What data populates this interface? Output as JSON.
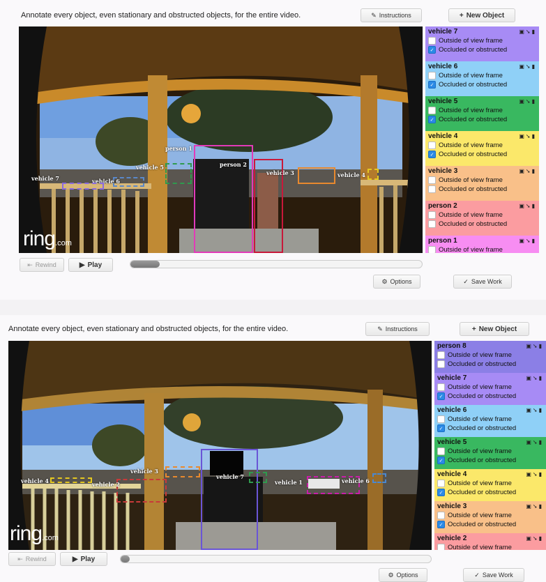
{
  "top": {
    "instruction": "Annotate every object, even stationary and obstructed objects, for the entire video.",
    "instructions_button": "Instructions",
    "new_object_button": "New Object",
    "rewind_button": "Rewind",
    "play_button": "Play",
    "options_button": "Options",
    "save_button": "Save Work",
    "progress": 0.1,
    "watermark": "ring",
    "watermark_suffix": ".com",
    "box_labels": {
      "person2": "person 2",
      "vehicle3": "vehicle 3",
      "vehicle4": "vehicle 4",
      "vehicle5": "vehicle 5",
      "vehicle6": "vehicle 6",
      "vehicle7": "vehicle 7",
      "person1": "person 1"
    },
    "objects": [
      {
        "name": "vehicle 7",
        "color": "#a78bf5",
        "outside": false,
        "occluded": true
      },
      {
        "name": "vehicle 6",
        "color": "#8fd0f7",
        "outside": false,
        "occluded": true
      },
      {
        "name": "vehicle 5",
        "color": "#39b860",
        "outside": false,
        "occluded": true
      },
      {
        "name": "vehicle 4",
        "color": "#fbe86a",
        "outside": false,
        "occluded": true
      },
      {
        "name": "vehicle 3",
        "color": "#f9c089",
        "outside": false,
        "occluded": false
      },
      {
        "name": "person 2",
        "color": "#fb9ca0",
        "outside": false,
        "occluded": false
      },
      {
        "name": "person 1",
        "color": "#f78df2",
        "outside": false,
        "occluded": false
      }
    ],
    "labels": {
      "outside": "Outside of view frame",
      "occluded": "Occluded or obstructed"
    }
  },
  "bottom": {
    "instruction": "Annotate every object, even stationary and obstructed objects, for the entire video.",
    "instructions_button": "Instructions",
    "new_object_button": "New Object",
    "rewind_button": "Rewind",
    "play_button": "Play",
    "options_button": "Options",
    "save_button": "Save Work",
    "progress": 0.03,
    "watermark": "ring",
    "watermark_suffix": ".com",
    "box_labels": {
      "vehicle7": "vehicle 7",
      "vehicle1": "vehicle 1",
      "vehicle6": "vehicle 6",
      "vehicle4": "vehicle 4",
      "vehicle2": "vehicle 2",
      "vehicle3": "vehicle 3",
      "vehicle5": "vehicle 5"
    },
    "objects": [
      {
        "name": "person 8",
        "color": "#8b7fe6",
        "outside": false,
        "occluded": false
      },
      {
        "name": "vehicle 7",
        "color": "#a78bf5",
        "outside": false,
        "occluded": true
      },
      {
        "name": "vehicle 6",
        "color": "#8fd0f7",
        "outside": false,
        "occluded": true
      },
      {
        "name": "vehicle 5",
        "color": "#39b860",
        "outside": false,
        "occluded": true
      },
      {
        "name": "vehicle 4",
        "color": "#fbe86a",
        "outside": false,
        "occluded": true
      },
      {
        "name": "vehicle 3",
        "color": "#f9c089",
        "outside": false,
        "occluded": true
      },
      {
        "name": "vehicle 2",
        "color": "#fb9ca0",
        "outside": false,
        "occluded": false
      }
    ],
    "labels": {
      "outside": "Outside of view frame",
      "occluded": "Occluded or obstructed"
    }
  }
}
